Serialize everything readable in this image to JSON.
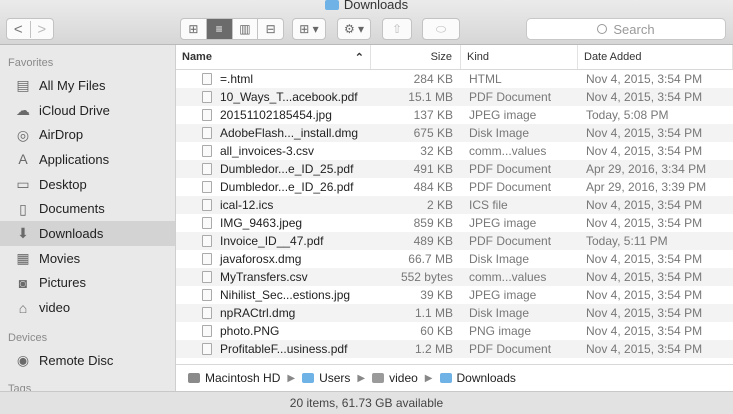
{
  "window": {
    "title": "Downloads"
  },
  "toolbar": {
    "back": "<",
    "forward": ">",
    "view_icons": [
      "⊞",
      "≡",
      "▥",
      "⊟"
    ],
    "arrange": "⊞ ▾",
    "action": "⚙ ▾",
    "share": "⇧",
    "tags": "⬭",
    "search_placeholder": "Search"
  },
  "sidebar": {
    "favorites_label": "Favorites",
    "favorites": [
      {
        "label": "All My Files",
        "icon": "all-files-icon",
        "glyph": "▤"
      },
      {
        "label": "iCloud Drive",
        "icon": "cloud-icon",
        "glyph": "☁"
      },
      {
        "label": "AirDrop",
        "icon": "airdrop-icon",
        "glyph": "◎"
      },
      {
        "label": "Applications",
        "icon": "applications-icon",
        "glyph": "A"
      },
      {
        "label": "Desktop",
        "icon": "desktop-icon",
        "glyph": "▭"
      },
      {
        "label": "Documents",
        "icon": "documents-icon",
        "glyph": "▯"
      },
      {
        "label": "Downloads",
        "icon": "downloads-icon",
        "glyph": "⬇"
      },
      {
        "label": "Movies",
        "icon": "movies-icon",
        "glyph": "▦"
      },
      {
        "label": "Pictures",
        "icon": "pictures-icon",
        "glyph": "◙"
      },
      {
        "label": "video",
        "icon": "home-icon",
        "glyph": "⌂"
      }
    ],
    "devices_label": "Devices",
    "devices": [
      {
        "label": "Remote Disc",
        "icon": "disc-icon",
        "glyph": "◉"
      }
    ],
    "tags_label": "Tags"
  },
  "columns": {
    "name": "Name",
    "size": "Size",
    "kind": "Kind",
    "date": "Date Added"
  },
  "files": [
    {
      "name": "=.html",
      "size": "284 KB",
      "kind": "HTML",
      "date": "Nov 4, 2015, 3:54 PM"
    },
    {
      "name": "10_Ways_T...acebook.pdf",
      "size": "15.1 MB",
      "kind": "PDF Document",
      "date": "Nov 4, 2015, 3:54 PM"
    },
    {
      "name": "20151102185454.jpg",
      "size": "137 KB",
      "kind": "JPEG image",
      "date": "Today, 5:08 PM"
    },
    {
      "name": "AdobeFlash..._install.dmg",
      "size": "675 KB",
      "kind": "Disk Image",
      "date": "Nov 4, 2015, 3:54 PM"
    },
    {
      "name": "all_invoices-3.csv",
      "size": "32 KB",
      "kind": "comm...values",
      "date": "Nov 4, 2015, 3:54 PM"
    },
    {
      "name": "Dumbledor...e_ID_25.pdf",
      "size": "491 KB",
      "kind": "PDF Document",
      "date": "Apr 29, 2016, 3:34 PM"
    },
    {
      "name": "Dumbledor...e_ID_26.pdf",
      "size": "484 KB",
      "kind": "PDF Document",
      "date": "Apr 29, 2016, 3:39 PM"
    },
    {
      "name": "ical-12.ics",
      "size": "2 KB",
      "kind": "ICS file",
      "date": "Nov 4, 2015, 3:54 PM"
    },
    {
      "name": "IMG_9463.jpeg",
      "size": "859 KB",
      "kind": "JPEG image",
      "date": "Nov 4, 2015, 3:54 PM"
    },
    {
      "name": "Invoice_ID__47.pdf",
      "size": "489 KB",
      "kind": "PDF Document",
      "date": "Today, 5:11 PM"
    },
    {
      "name": "javaforosx.dmg",
      "size": "66.7 MB",
      "kind": "Disk Image",
      "date": "Nov 4, 2015, 3:54 PM"
    },
    {
      "name": "MyTransfers.csv",
      "size": "552 bytes",
      "kind": "comm...values",
      "date": "Nov 4, 2015, 3:54 PM"
    },
    {
      "name": "Nihilist_Sec...estions.jpg",
      "size": "39 KB",
      "kind": "JPEG image",
      "date": "Nov 4, 2015, 3:54 PM"
    },
    {
      "name": "npRACtrl.dmg",
      "size": "1.1 MB",
      "kind": "Disk Image",
      "date": "Nov 4, 2015, 3:54 PM"
    },
    {
      "name": "photo.PNG",
      "size": "60 KB",
      "kind": "PNG image",
      "date": "Nov 4, 2015, 3:54 PM"
    },
    {
      "name": "ProfitableF...usiness.pdf",
      "size": "1.2 MB",
      "kind": "PDF Document",
      "date": "Nov 4, 2015, 3:54 PM"
    }
  ],
  "pathbar": [
    {
      "label": "Macintosh HD",
      "icon": "hard-drive-icon",
      "color": "#8a8a8a"
    },
    {
      "label": "Users",
      "icon": "folder-icon",
      "color": "#6fb2e6"
    },
    {
      "label": "video",
      "icon": "home-icon",
      "color": "#9a9a9a"
    },
    {
      "label": "Downloads",
      "icon": "folder-icon",
      "color": "#6fb2e6"
    }
  ],
  "status": "20 items, 61.73 GB available",
  "colors": {
    "folder": "#6fb2e6",
    "selected_view": "#6b6b6b",
    "sidebar_active": "#d3d3d3"
  }
}
